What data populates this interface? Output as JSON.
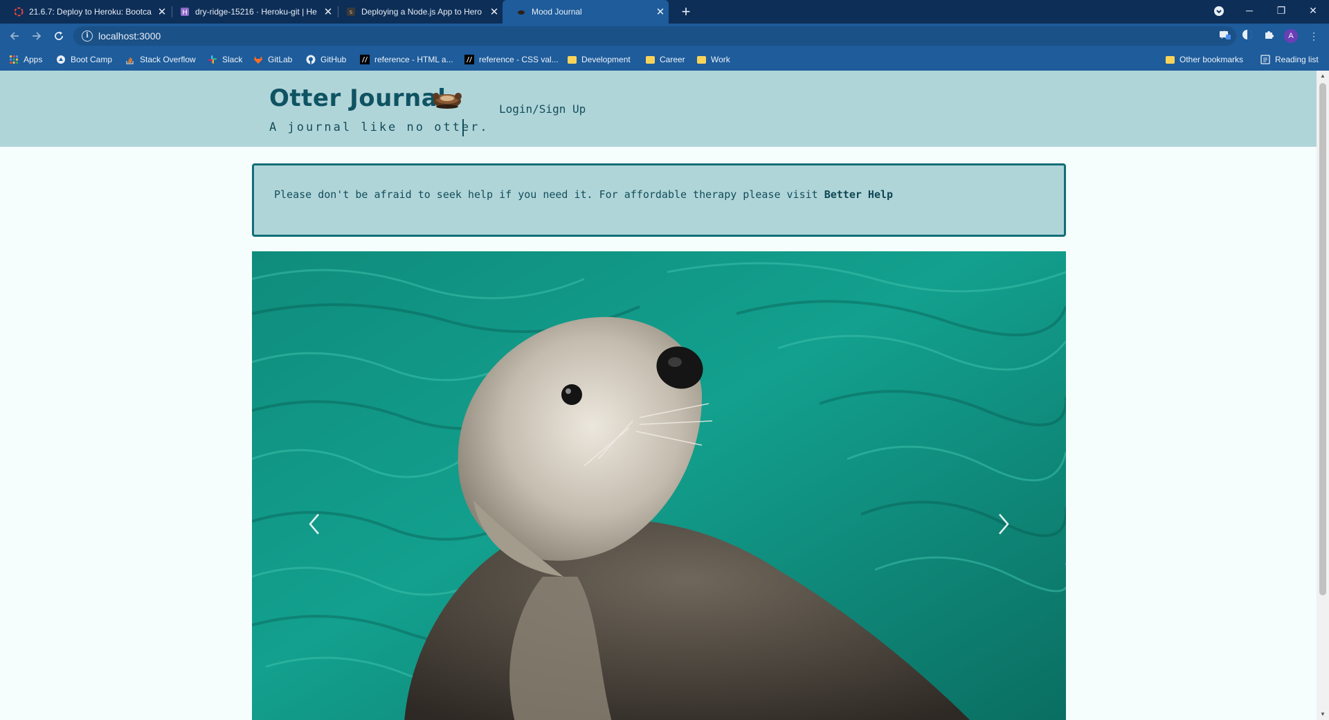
{
  "browser": {
    "tabs": [
      {
        "title": "21.6.7: Deploy to Heroku: Bootca",
        "active": false
      },
      {
        "title": "dry-ridge-15216 · Heroku-git | He",
        "active": false
      },
      {
        "title": "Deploying a Node.js App to Hero",
        "active": false
      },
      {
        "title": "Mood Journal",
        "active": true
      }
    ],
    "url": "localhost:3000",
    "profile_initial": "A",
    "bookmarks": [
      {
        "label": "Apps",
        "icon": "apps-grid-icon"
      },
      {
        "label": "Boot Camp",
        "icon": "bootcamp-icon"
      },
      {
        "label": "Stack Overflow",
        "icon": "stackoverflow-icon"
      },
      {
        "label": "Slack",
        "icon": "slack-icon"
      },
      {
        "label": "GitLab",
        "icon": "gitlab-icon"
      },
      {
        "label": "GitHub",
        "icon": "github-icon"
      },
      {
        "label": "reference - HTML a...",
        "icon": "mdn-icon"
      },
      {
        "label": "reference - CSS val...",
        "icon": "mdn-icon"
      },
      {
        "label": "Development",
        "icon": "folder-icon"
      },
      {
        "label": "Career",
        "icon": "folder-icon"
      },
      {
        "label": "Work",
        "icon": "folder-icon"
      }
    ],
    "other_bookmarks": "Other bookmarks",
    "reading_list": "Reading list"
  },
  "site": {
    "title": "Otter Journal",
    "tagline": "A journal like no otter.",
    "login_link": "Login/Sign Up"
  },
  "notice": {
    "text": "Please don't be afraid to seek help if you need it. For affordable therapy please visit ",
    "link_text": "Better Help"
  },
  "carousel": {
    "image": "sea-otter-floating-in-turquoise-water",
    "prev_icon": "chevron-left-icon",
    "next_icon": "chevron-right-icon"
  },
  "colors": {
    "header_bg": "#b0d5d9",
    "accent": "#126d76",
    "text": "#124d5a",
    "browser_frame": "#1e5c9b"
  }
}
